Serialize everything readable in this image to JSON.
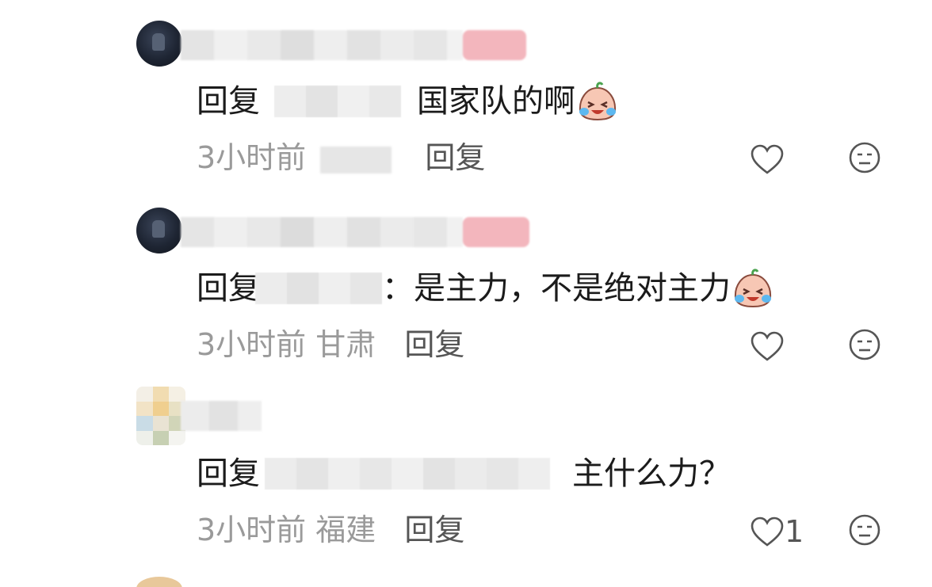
{
  "comments": [
    {
      "reply_prefix": "回复",
      "text": "国家队的啊",
      "time": "3小时前",
      "location": "",
      "reply_label": "回复",
      "like_count": "",
      "emoji": "crying-laughing-emoji"
    },
    {
      "reply_prefix": "回复",
      "text": "：是主力，不是绝对主力",
      "time": "3小时前",
      "location": "甘肃",
      "reply_label": "回复",
      "like_count": "",
      "emoji": "crying-laughing-emoji"
    },
    {
      "reply_prefix": "回复",
      "text": "主什么力？",
      "time": "3小时前",
      "location": "福建",
      "reply_label": "回复",
      "like_count": "1",
      "emoji": ""
    }
  ],
  "icons": {
    "like": "heart-outline-icon",
    "dislike": "meh-face-icon"
  },
  "colors": {
    "text": "#1b1b1b",
    "meta": "#9a9a9a",
    "pink_badge": "#f3b6bd"
  }
}
